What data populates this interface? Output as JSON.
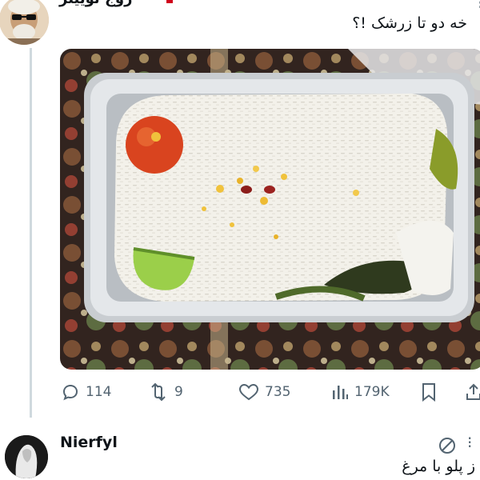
{
  "tweet": {
    "author_name": "زوج توییتر",
    "text": "خه دو تا زرشک !؟",
    "more_label": "⁝",
    "image_alt": "Rice with lime, tomato and green peppers in a foil tray",
    "stats": {
      "replies": "114",
      "retweets": "9",
      "likes": "735",
      "views": "179K"
    }
  },
  "reply": {
    "author_name": "Nierfyl",
    "more_label": "⁝",
    "text": "ز پلو با مرغ"
  },
  "colors": {
    "text": "#0f1419",
    "muted": "#536471",
    "thread_line": "#cfd9de"
  },
  "icons": [
    "reply-icon",
    "retweet-icon",
    "heart-icon",
    "views-icon",
    "bookmark-icon",
    "share-icon",
    "no-entry-icon"
  ]
}
